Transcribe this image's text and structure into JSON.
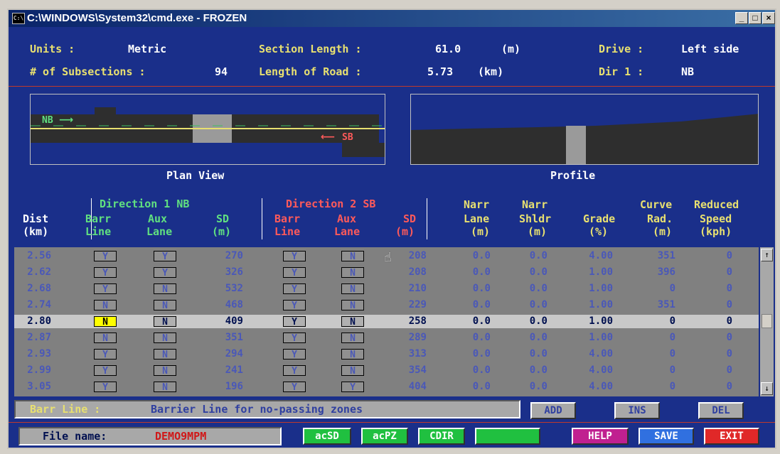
{
  "window": {
    "title": "C:\\WINDOWS\\System32\\cmd.exe - FROZEN",
    "icon_label": "C:\\",
    "min": "_",
    "max": "□",
    "close": "×"
  },
  "header": {
    "units_label": "Units :",
    "units_value": "Metric",
    "section_length_label": "Section Length :",
    "section_length_value": "61.0",
    "section_length_unit": "(m)",
    "drive_label": "Drive :",
    "drive_value": "Left side",
    "subsections_label": "# of Subsections :",
    "subsections_value": "94",
    "length_road_label": "Length of Road :",
    "length_road_value": "5.73",
    "length_road_unit": "(km)",
    "dir1_label": "Dir 1 :",
    "dir1_value": "NB"
  },
  "plan_view": {
    "caption": "Plan View",
    "nb_label": "NB",
    "sb_label": "SB"
  },
  "profile": {
    "caption": "Profile"
  },
  "columns": {
    "dir1_title": "Direction 1 NB",
    "dir2_title": "Direction 2 SB",
    "dist": [
      "Dist",
      "(km)"
    ],
    "barr1": [
      "Barr",
      "Line"
    ],
    "aux1": [
      "Aux",
      "Lane"
    ],
    "sd1": [
      "SD",
      "(m)"
    ],
    "barr2": [
      "Barr",
      "Line"
    ],
    "aux2": [
      "Aux",
      "Lane"
    ],
    "sd2": [
      "SD",
      "(m)"
    ],
    "narr_lane": [
      "Narr",
      "Lane",
      "(m)"
    ],
    "narr_shldr": [
      "Narr",
      "Shldr",
      "(m)"
    ],
    "grade": [
      "Grade",
      "(%)"
    ],
    "curve": [
      "Curve",
      "Rad.",
      "(m)"
    ],
    "reduced": [
      "Reduced",
      "Speed",
      "(kph)"
    ]
  },
  "rows": [
    {
      "dist": "2.56",
      "barr1": "Y",
      "aux1": "Y",
      "sd1": "270",
      "barr2": "Y",
      "aux2": "N",
      "sd2": "208",
      "lane": "0.0",
      "shldr": "0.0",
      "grade": "4.00",
      "curve": "351",
      "speed": "0"
    },
    {
      "dist": "2.62",
      "barr1": "Y",
      "aux1": "Y",
      "sd1": "326",
      "barr2": "Y",
      "aux2": "N",
      "sd2": "208",
      "lane": "0.0",
      "shldr": "0.0",
      "grade": "1.00",
      "curve": "396",
      "speed": "0"
    },
    {
      "dist": "2.68",
      "barr1": "Y",
      "aux1": "N",
      "sd1": "532",
      "barr2": "Y",
      "aux2": "N",
      "sd2": "210",
      "lane": "0.0",
      "shldr": "0.0",
      "grade": "1.00",
      "curve": "0",
      "speed": "0"
    },
    {
      "dist": "2.74",
      "barr1": "N",
      "aux1": "N",
      "sd1": "468",
      "barr2": "Y",
      "aux2": "N",
      "sd2": "229",
      "lane": "0.0",
      "shldr": "0.0",
      "grade": "1.00",
      "curve": "351",
      "speed": "0"
    },
    {
      "dist": "2.80",
      "barr1": "N",
      "aux1": "N",
      "sd1": "409",
      "barr2": "Y",
      "aux2": "N",
      "sd2": "258",
      "lane": "0.0",
      "shldr": "0.0",
      "grade": "1.00",
      "curve": "0",
      "speed": "0"
    },
    {
      "dist": "2.87",
      "barr1": "N",
      "aux1": "N",
      "sd1": "351",
      "barr2": "Y",
      "aux2": "N",
      "sd2": "289",
      "lane": "0.0",
      "shldr": "0.0",
      "grade": "1.00",
      "curve": "0",
      "speed": "0"
    },
    {
      "dist": "2.93",
      "barr1": "Y",
      "aux1": "N",
      "sd1": "294",
      "barr2": "Y",
      "aux2": "N",
      "sd2": "313",
      "lane": "0.0",
      "shldr": "0.0",
      "grade": "4.00",
      "curve": "0",
      "speed": "0"
    },
    {
      "dist": "2.99",
      "barr1": "Y",
      "aux1": "N",
      "sd1": "241",
      "barr2": "Y",
      "aux2": "N",
      "sd2": "354",
      "lane": "0.0",
      "shldr": "0.0",
      "grade": "4.00",
      "curve": "0",
      "speed": "0"
    },
    {
      "dist": "3.05",
      "barr1": "Y",
      "aux1": "N",
      "sd1": "196",
      "barr2": "Y",
      "aux2": "Y",
      "sd2": "404",
      "lane": "0.0",
      "shldr": "0.0",
      "grade": "4.00",
      "curve": "0",
      "speed": "0"
    }
  ],
  "selected_row_index": 4,
  "scroll": {
    "up": "↑",
    "down": "↓"
  },
  "help_line": {
    "field": "Barr Line :",
    "text": "Barrier Line for no-passing zones"
  },
  "row_buttons": {
    "add": "ADD",
    "ins": "INS",
    "del": "DEL"
  },
  "footer": {
    "file_label": "File name:",
    "file_value": "DEMO9MPM",
    "acsd": "acSD",
    "acpz": "acPZ",
    "cdir": "CDIR",
    "blank": "",
    "help": "HELP",
    "save": "SAVE",
    "exit": "EXIT"
  },
  "colors": {
    "background": "#1a2f8a",
    "accent_yellow": "#e8e070",
    "dir1_green": "#60e080",
    "dir2_red": "#ff5a5a",
    "selected_yellow": "#ffff00"
  }
}
